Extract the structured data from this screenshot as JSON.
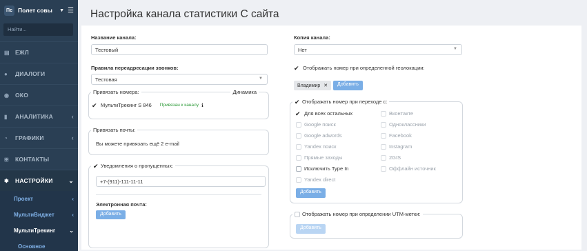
{
  "sidebar": {
    "logo": "Пс",
    "project": "Полет совы",
    "search_placeholder": "Найти...",
    "items": [
      {
        "label": "ЕЖЛ",
        "icon": "book-icon",
        "glyph": "▤"
      },
      {
        "label": "ДИАЛОГИ",
        "icon": "chat-icon",
        "glyph": "●"
      },
      {
        "label": "ОКО",
        "icon": "eye-icon",
        "glyph": "◉"
      },
      {
        "label": "АНАЛИТИКА",
        "icon": "bar-chart-icon",
        "glyph": "▮"
      },
      {
        "label": "ГРАФИКИ",
        "icon": "pie-chart-icon",
        "glyph": "◔"
      },
      {
        "label": "КОНТАКТЫ",
        "icon": "contacts-icon",
        "glyph": "⊞"
      },
      {
        "label": "НАСТРОЙКИ",
        "icon": "gear-icon",
        "glyph": "✱"
      }
    ],
    "sub_items": [
      {
        "label": "Проект"
      },
      {
        "label": "МультиВиджет"
      },
      {
        "label": "МультиТрекинг"
      },
      {
        "label": "Основное"
      }
    ]
  },
  "page": {
    "title": "Настройка канала статистики С сайта"
  },
  "left": {
    "channel_name_label": "Название канала:",
    "channel_name_value": "Тестовый",
    "redirect_label": "Правила переадресации звонков:",
    "redirect_value": "Тестовая",
    "bind_numbers_label": "Привязать номера:",
    "dynamics_label": "Динамика",
    "number_name": "МультиТрекинг S 846",
    "number_status": "Привязан к каналу",
    "bind_emails_label": "Привязать почты:",
    "emails_hint": "Вы можете привязать ещё 2 e-mail",
    "missed_label": "Уведомления о пропущенных:",
    "missed_phone": "+7-(911)-111-11-11",
    "email_label": "Электронная почта:",
    "add_button": "Добавить"
  },
  "right": {
    "copy_label": "Копия канала:",
    "copy_value": "Нет",
    "geo_label": "Отображать номер при определенной геолокации:",
    "geo_tag": "Владимир",
    "geo_add": "Добавить",
    "transition_label": "Отображать номер при переходе с:",
    "sources_left": [
      {
        "label": "Для всех остальных",
        "checked": true,
        "enabled": true
      },
      {
        "label": "Google поиск",
        "checked": false,
        "enabled": false
      },
      {
        "label": "Google adwords",
        "checked": false,
        "enabled": false
      },
      {
        "label": "Yandex поиск",
        "checked": false,
        "enabled": false
      },
      {
        "label": "Прямые заходы",
        "checked": false,
        "enabled": false
      },
      {
        "label": "Исключить Type In",
        "checked": false,
        "enabled": true
      },
      {
        "label": "Yandex direct",
        "checked": false,
        "enabled": false
      }
    ],
    "sources_right": [
      {
        "label": "Вконтакте",
        "checked": false,
        "enabled": false
      },
      {
        "label": "Одноклассники",
        "checked": false,
        "enabled": false
      },
      {
        "label": "Facebook",
        "checked": false,
        "enabled": false
      },
      {
        "label": "Instagram",
        "checked": false,
        "enabled": false
      },
      {
        "label": "2GIS",
        "checked": false,
        "enabled": false
      },
      {
        "label": "Оффлайн источник",
        "checked": false,
        "enabled": false
      }
    ],
    "transition_add": "Добавить",
    "utm_label": "Отображать номер при определении UTM-метки:",
    "utm_add": "Добавить"
  },
  "colors": {
    "sidebar": "#2a3f54",
    "accent": "#7aaee6",
    "status_green": "#2e9b3a"
  }
}
